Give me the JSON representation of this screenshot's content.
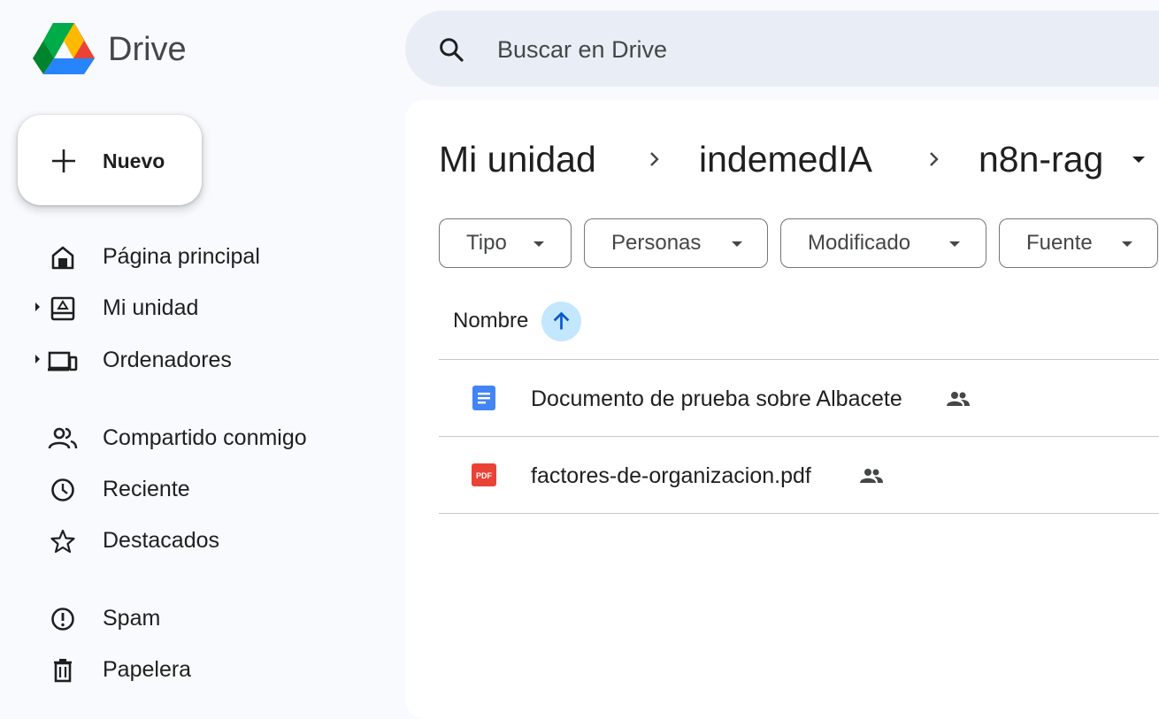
{
  "app": {
    "name": "Drive"
  },
  "search": {
    "placeholder": "Buscar en Drive"
  },
  "new_button": {
    "label": "Nuevo"
  },
  "sidebar": {
    "items": [
      {
        "label": "Página principal",
        "icon": "home-icon",
        "expandable": false
      },
      {
        "label": "Mi unidad",
        "icon": "my-drive-icon",
        "expandable": true
      },
      {
        "label": "Ordenadores",
        "icon": "computers-icon",
        "expandable": true
      },
      {
        "label": "Compartido conmigo",
        "icon": "shared-with-me-icon",
        "expandable": false
      },
      {
        "label": "Reciente",
        "icon": "clock-icon",
        "expandable": false
      },
      {
        "label": "Destacados",
        "icon": "star-icon",
        "expandable": false
      },
      {
        "label": "Spam",
        "icon": "spam-icon",
        "expandable": false
      },
      {
        "label": "Papelera",
        "icon": "trash-icon",
        "expandable": false
      }
    ]
  },
  "breadcrumb": {
    "items": [
      "Mi unidad",
      "indemedIA",
      "n8n-rag"
    ]
  },
  "filters": {
    "chips": [
      "Tipo",
      "Personas",
      "Modificado",
      "Fuente"
    ]
  },
  "list": {
    "column_name": "Nombre",
    "sort": "ascending",
    "files": [
      {
        "name": "Documento de prueba sobre Albacete",
        "type": "google-doc",
        "shared": true
      },
      {
        "name": "factores-de-organizacion.pdf",
        "type": "pdf",
        "shared": true
      }
    ]
  },
  "colors": {
    "accent": "#0b57d0",
    "sort_bg": "#c2e7ff",
    "doc_blue": "#4285f4",
    "pdf_red": "#ea4335",
    "background": "#f8fafd"
  }
}
